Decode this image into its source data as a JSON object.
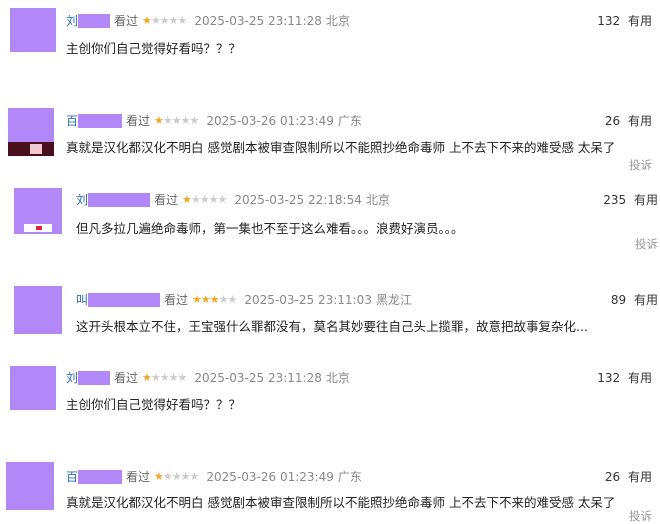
{
  "comments": [
    {
      "name": "刘",
      "watched": "看过",
      "rating": 1,
      "time": "2025-03-25 23:11:28",
      "location": "北京",
      "useful_count": "132",
      "useful_label": "有用",
      "text": "主创你们自己觉得好看吗？？？",
      "report": ""
    },
    {
      "name": "百",
      "watched": "看过",
      "rating": 1,
      "time": "2025-03-26 01:23:49",
      "location": "广东",
      "useful_count": "26",
      "useful_label": "有用",
      "text": "真就是汉化都汉化不明白 感觉剧本被审查限制所以不能照抄绝命毒师 上不去下不来的难受感 太呆了",
      "report": "投诉"
    },
    {
      "name": "刘",
      "watched": "看过",
      "rating": 1,
      "time": "2025-03-25 22:18:54",
      "location": "北京",
      "useful_count": "235",
      "useful_label": "有用",
      "text": "但凡多拉几遍绝命毒师，第一集也不至于这么难看。。。浪费好演员。。。",
      "report": "投诉"
    },
    {
      "name": "叫",
      "watched": "看过",
      "rating": 3,
      "time": "2025-03-25 23:11:03",
      "location": "黑龙江",
      "useful_count": "89",
      "useful_label": "有用",
      "text": "这开头根本立不住，王宝强什么罪都没有，莫名其妙要往自己头上揽罪，故意把故事复杂化...",
      "report": ""
    },
    {
      "name": "刘",
      "watched": "看过",
      "rating": 1,
      "time": "2025-03-25 23:11:28",
      "location": "北京",
      "useful_count": "132",
      "useful_label": "有用",
      "text": "主创你们自己觉得好看吗？？？",
      "report": ""
    },
    {
      "name": "百",
      "watched": "看过",
      "rating": 1,
      "time": "2025-03-26 01:23:49",
      "location": "广东",
      "useful_count": "26",
      "useful_label": "有用",
      "text": "真就是汉化都汉化不明白 感觉剧本被审查限制所以不能照抄绝命毒师 上不去下不来的难受感 太呆了",
      "report": "投诉"
    }
  ],
  "colors": {
    "censor": "#b287f7",
    "star_on": "#f6a623",
    "star_off": "#cccccc",
    "name": "#2d6fb7"
  },
  "icons": {
    "star": "star-icon"
  }
}
